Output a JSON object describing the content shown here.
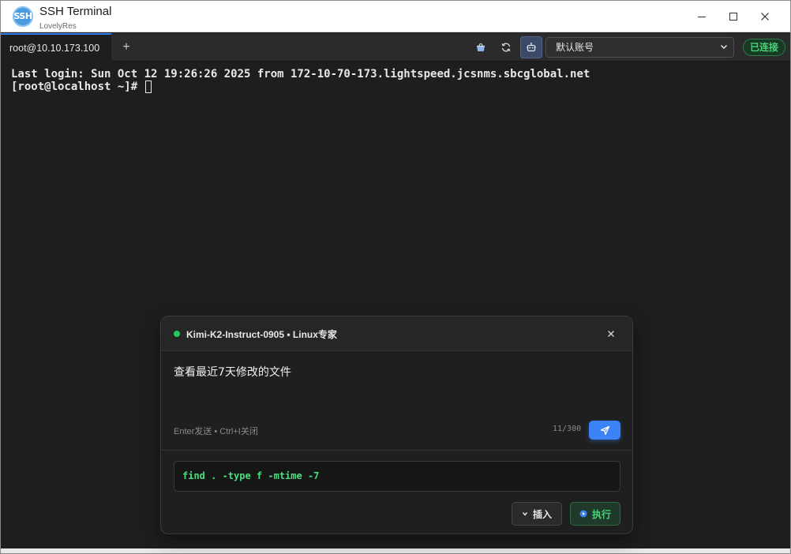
{
  "window": {
    "app_logo_text": "SSH",
    "title": "SSH Terminal",
    "subtitle": "LovelyRes",
    "controls": [
      "minimize",
      "maximize",
      "close"
    ]
  },
  "tabs": {
    "items": [
      {
        "label": "root@10.10.173.100",
        "active": true
      }
    ],
    "add_label": "+"
  },
  "toolbar": {
    "icons": [
      "basket-icon",
      "refresh-icon",
      "robot-icon"
    ],
    "account_select": {
      "value": "默认账号"
    },
    "status": "已连接"
  },
  "terminal": {
    "lines": [
      "Last login: Sun Oct 12 19:26:26 2025 from 172-10-70-173.lightspeed.jcsnms.sbcglobal.net",
      "[root@localhost ~]# "
    ]
  },
  "ai_dialog": {
    "status_color": "#22c55e",
    "title": "Kimi-K2-Instruct-0905 • Linux专家",
    "input_value": "查看最近7天修改的文件",
    "hint": "Enter发送 • Ctrl+I关闭",
    "counter": "11/300",
    "result_command": "find . -type f -mtime -7",
    "insert_label": "插入",
    "execute_label": "执行"
  },
  "colors": {
    "accent": "#3b82f6",
    "success": "#4ad17a",
    "terminal_bg": "#1e1e1e"
  }
}
